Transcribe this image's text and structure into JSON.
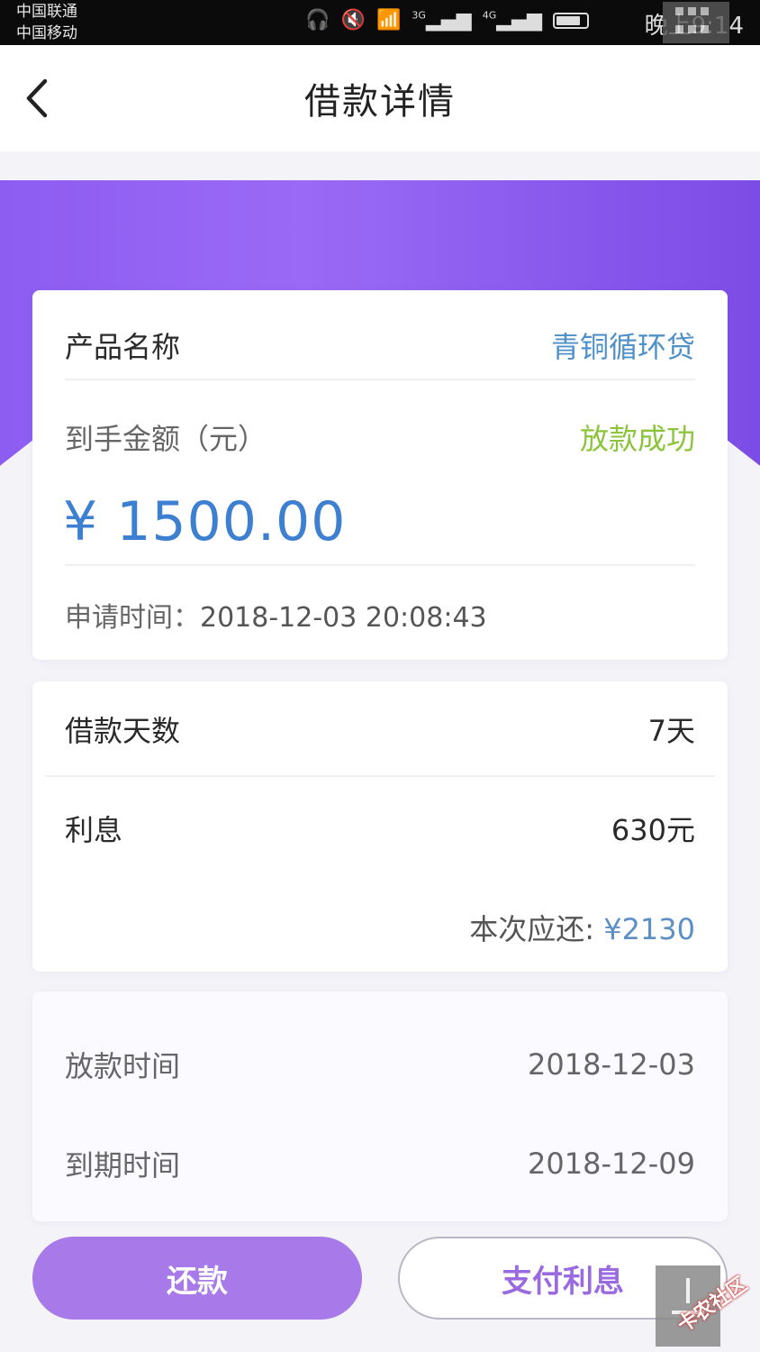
{
  "status_bar": {
    "carrier1": "中国联通",
    "carrier2": "中国移动",
    "net1": "3G",
    "net2": "4G",
    "time": "晚上9:14"
  },
  "header": {
    "title": "借款详情",
    "back_icon": "chevron-left-icon"
  },
  "card1": {
    "product_label": "产品名称",
    "product_value": "青铜循环贷",
    "amount_label": "到手金额（元）",
    "status": "放款成功",
    "amount": "¥ 1500.00",
    "apply_label": "申请时间：",
    "apply_time": "2018-12-03 20:08:43"
  },
  "card2": {
    "days_label": "借款天数",
    "days_value": "7天",
    "interest_label": "利息",
    "interest_value": "630元",
    "due_label": "本次应还:",
    "due_amount": "¥2130"
  },
  "card3": {
    "loan_time_label": "放款时间",
    "loan_time_value": "2018-12-03",
    "expire_label": "到期时间",
    "expire_value": "2018-12-09"
  },
  "buttons": {
    "repay": "还款",
    "pay_interest": "支付利息"
  },
  "watermark": "卡农社区",
  "colors": {
    "accent_purple": "#8d5cf1",
    "amount_blue": "#3d7fd0",
    "status_green": "#8cc43c"
  }
}
